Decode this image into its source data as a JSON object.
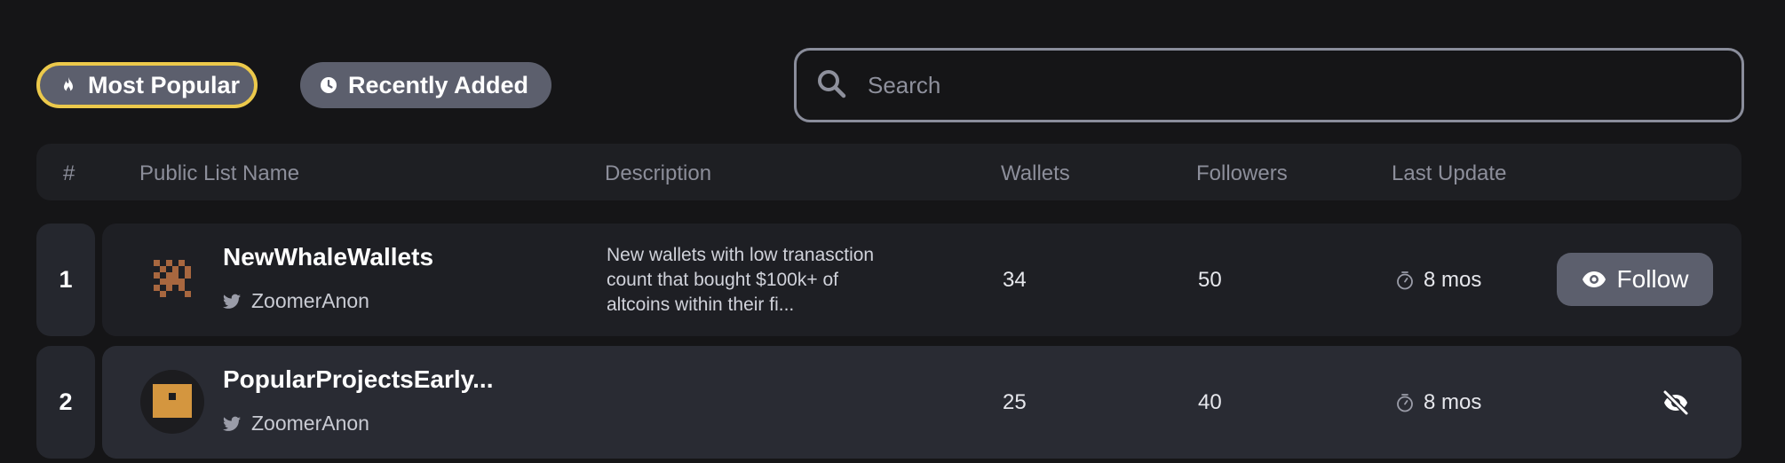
{
  "filters": {
    "most_popular": "Most Popular",
    "recently_added": "Recently Added"
  },
  "search": {
    "placeholder": "Search",
    "value": ""
  },
  "table": {
    "columns": [
      "#",
      "Public List Name",
      "Description",
      "Wallets",
      "Followers",
      "Last Update"
    ]
  },
  "rows": [
    {
      "rank": "1",
      "name": "NewWhaleWallets",
      "author": "ZoomerAnon",
      "description": "New wallets with low tranasction count that bought $100k+ of altcoins within their fi...",
      "wallets": "34",
      "followers": "50",
      "last_update": "8 mos",
      "action": "Follow",
      "avatar_icon": "pixel-avatar-icon"
    },
    {
      "rank": "2",
      "name": "PopularProjectsEarly...",
      "author": "ZoomerAnon",
      "description": "",
      "wallets": "25",
      "followers": "40",
      "last_update": "8 mos",
      "action": "",
      "avatar_icon": "pixel-avatar-icon"
    }
  ],
  "colors": {
    "active_filter_border": "#ecc94b",
    "button_bg": "#5c5f6d",
    "avatar_1": "#a8673f",
    "avatar_2": "#d4963f"
  }
}
